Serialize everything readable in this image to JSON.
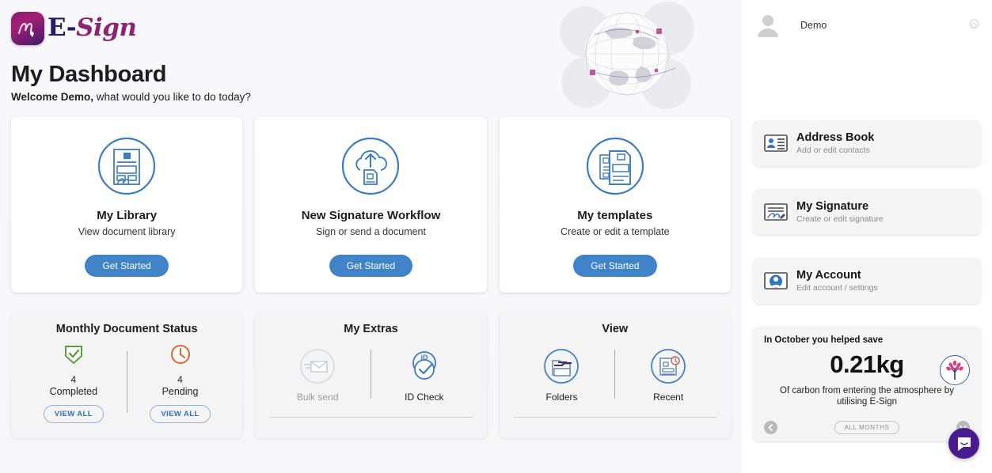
{
  "brand": {
    "logo_text_e": "E-",
    "logo_text_sign": "Sign",
    "accent_blue": "#4083c7",
    "accent_purple": "#4a1b8c",
    "magenta": "#a51f78"
  },
  "header": {
    "page_title": "My Dashboard",
    "welcome_bold": "Welcome Demo,",
    "welcome_rest": " what would you like to do today?",
    "globe_icon": "globe-graphic"
  },
  "primary_cards": [
    {
      "icon": "document-signature-icon",
      "title": "My Library",
      "subtitle": "View document library",
      "button": "Get Started"
    },
    {
      "icon": "cloud-upload-icon",
      "title": "New Signature Workflow",
      "subtitle": "Sign or send a document",
      "button": "Get Started"
    },
    {
      "icon": "templates-icon",
      "title": "My templates",
      "subtitle": "Create or edit a template",
      "button": "Get Started"
    }
  ],
  "status_card": {
    "title": "Monthly Document Status",
    "items": [
      {
        "icon": "shield-check-icon",
        "count": "4",
        "label": "Completed",
        "button": "VIEW ALL",
        "color": "#5e9e3f"
      },
      {
        "icon": "clock-pending-icon",
        "count": "4",
        "label": "Pending",
        "button": "VIEW ALL",
        "color": "#e2622a"
      }
    ]
  },
  "extras_card": {
    "title": "My Extras",
    "items": [
      {
        "icon": "bulk-send-icon",
        "label": "Bulk send",
        "disabled": true
      },
      {
        "icon": "id-check-icon",
        "label": "ID Check",
        "disabled": false
      }
    ]
  },
  "view_card": {
    "title": "View",
    "items": [
      {
        "icon": "folders-icon",
        "label": "Folders"
      },
      {
        "icon": "recent-documents-icon",
        "label": "Recent"
      }
    ]
  },
  "sidebar": {
    "user": {
      "name": "Demo",
      "avatar_icon": "user-avatar-icon",
      "settings_icon": "gear-icon"
    },
    "links": [
      {
        "icon": "address-book-icon",
        "title": "Address Book",
        "subtitle": "Add or edit contacts"
      },
      {
        "icon": "signature-card-icon",
        "title": "My Signature",
        "subtitle": "Create or edit signature"
      },
      {
        "icon": "account-photo-icon",
        "title": "My Account",
        "subtitle": "Edit account / settings"
      }
    ],
    "carbon": {
      "heading": "In October you helped save",
      "amount": "0.21kg",
      "description": "Of carbon from entering the atmosphere by utilising E-Sign",
      "tree_icon": "tree-icon",
      "prev_icon": "chevron-left-circle-icon",
      "next_icon": "chevron-down-circle-icon",
      "months_button": "ALL MONTHS"
    },
    "chat": {
      "icon": "chat-bubble-icon"
    }
  }
}
